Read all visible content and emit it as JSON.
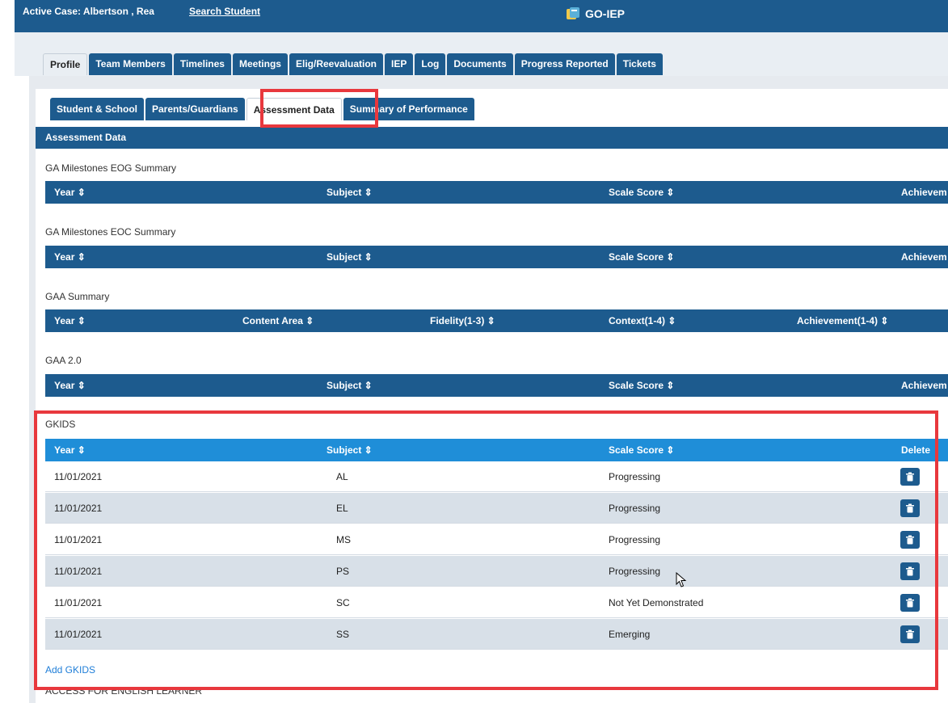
{
  "header": {
    "active_case": "Active Case: Albertson , Rea",
    "search_student": "Search Student",
    "app_name": "GO-IEP"
  },
  "main_tabs": [
    {
      "label": "Profile",
      "active": true
    },
    {
      "label": "Team Members"
    },
    {
      "label": "Timelines"
    },
    {
      "label": "Meetings"
    },
    {
      "label": "Elig/Reevaluation"
    },
    {
      "label": "IEP"
    },
    {
      "label": "Log"
    },
    {
      "label": "Documents"
    },
    {
      "label": "Progress Reported"
    },
    {
      "label": "Tickets"
    }
  ],
  "sub_tabs": [
    {
      "label": "Student & School"
    },
    {
      "label": "Parents/Guardians"
    },
    {
      "label": "Assessment Data",
      "active": true
    },
    {
      "label": "Summary of Performance"
    }
  ],
  "section_title": "Assessment Data",
  "tables": {
    "eog": {
      "title": "GA Milestones EOG Summary",
      "headers": [
        "Year ⇕",
        "Subject ⇕",
        "Scale Score ⇕",
        "Achievem"
      ]
    },
    "eoc": {
      "title": "GA Milestones EOC Summary",
      "headers": [
        "Year ⇕",
        "Subject ⇕",
        "Scale Score ⇕",
        "Achievem"
      ]
    },
    "gaa": {
      "title": "GAA Summary",
      "headers": [
        "Year ⇕",
        "Content Area ⇕",
        "Fidelity(1-3) ⇕",
        "Context(1-4) ⇕",
        "Achievement(1-4) ⇕"
      ]
    },
    "gaa2": {
      "title": "GAA 2.0",
      "headers": [
        "Year ⇕",
        "Subject ⇕",
        "Scale Score ⇕",
        "Achievem"
      ]
    },
    "gkids": {
      "title": "GKIDS",
      "headers": [
        "Year ⇕",
        "Subject ⇕",
        "Scale Score ⇕",
        "Delete"
      ],
      "rows": [
        {
          "year": "11/01/2021",
          "subject": "AL",
          "score": "Progressing"
        },
        {
          "year": "11/01/2021",
          "subject": "EL",
          "score": "Progressing"
        },
        {
          "year": "11/01/2021",
          "subject": "MS",
          "score": "Progressing"
        },
        {
          "year": "11/01/2021",
          "subject": "PS",
          "score": "Progressing"
        },
        {
          "year": "11/01/2021",
          "subject": "SC",
          "score": "Not Yet Demonstrated"
        },
        {
          "year": "11/01/2021",
          "subject": "SS",
          "score": "Emerging"
        }
      ],
      "add_label": "Add GKIDS"
    },
    "access": {
      "title": "ACCESS FOR ENGLISH LEARNER"
    }
  },
  "colors": {
    "primary": "#1d5b8e",
    "active_header": "#1f8ed8",
    "highlight": "#e8383d",
    "link": "#1f7ed8"
  },
  "icons": {
    "logo": "book-logo-icon",
    "trash": "trash-icon",
    "sort": "sort-icon",
    "cursor": "mouse-cursor-icon"
  }
}
